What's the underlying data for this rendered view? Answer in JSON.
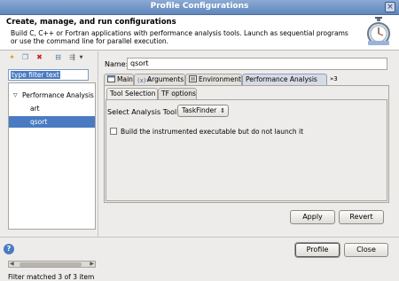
{
  "window": {
    "title": "Profile Configurations",
    "close_glyph": "×"
  },
  "header": {
    "title": "Create, manage, and run configurations",
    "description": "Build C, C++ or Fortran applications with performance analysis tools.  Launch as sequential programs or use the command line for parallel execution.",
    "icon": "stopwatch-icon"
  },
  "left": {
    "toolbar": [
      {
        "name": "new-config-icon",
        "glyph": "✦"
      },
      {
        "name": "duplicate-icon",
        "glyph": "❐"
      },
      {
        "name": "delete-icon",
        "glyph": "✖"
      },
      {
        "name": "collapse-all-icon",
        "glyph": "⊟"
      },
      {
        "name": "filter-icon",
        "glyph": "⇶"
      }
    ],
    "filter_text": "type filter text",
    "tree": {
      "root": "Performance Analysis",
      "children": [
        "art",
        "qsort"
      ],
      "selected": "qsort"
    },
    "status": "Filter matched 3 of 3 item"
  },
  "config": {
    "name_label": "Name:",
    "name_value": "qsort",
    "tabs": [
      "Main",
      "Arguments",
      "Environment",
      "Performance Analysis"
    ],
    "tabs_more": "»3",
    "active_tab": "Performance Analysis",
    "subtabs": [
      "Tool Selection",
      "TF options"
    ],
    "active_subtab": "Tool Selection",
    "tool_label": "Select Analysis Tool:",
    "tool_value": "TaskFinder",
    "checkbox_label": "Build the instrumented executable but do not launch it",
    "checkbox_checked": false,
    "apply": "Apply",
    "revert": "Revert"
  },
  "footer": {
    "help": "?",
    "profile": "Profile",
    "close": "Close"
  }
}
